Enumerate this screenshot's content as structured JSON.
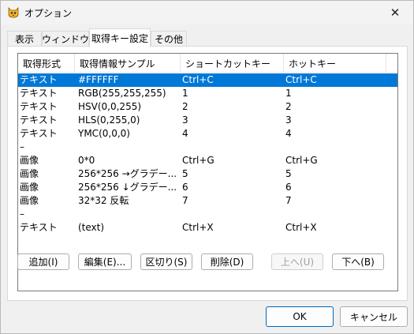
{
  "window": {
    "title": "オプション",
    "close_glyph": "✕"
  },
  "tabs": [
    {
      "label": "表示"
    },
    {
      "label": "ウィンドウ"
    },
    {
      "label": "取得キー設定"
    },
    {
      "label": "その他"
    }
  ],
  "list": {
    "headers": [
      "取得形式",
      "取得情報サンプル",
      "ショートカットキー",
      "ホットキー"
    ],
    "rows": [
      {
        "format": "テキスト",
        "sample": "#FFFFFF",
        "shortcut": "Ctrl+C",
        "hotkey": "Ctrl+C",
        "selected": true
      },
      {
        "format": "テキスト",
        "sample": "RGB(255,255,255)",
        "shortcut": "1",
        "hotkey": "1"
      },
      {
        "format": "テキスト",
        "sample": "HSV(0,0,255)",
        "shortcut": "2",
        "hotkey": "2"
      },
      {
        "format": "テキスト",
        "sample": "HLS(0,255,0)",
        "shortcut": "3",
        "hotkey": "3"
      },
      {
        "format": "テキスト",
        "sample": "YMC(0,0,0)",
        "shortcut": "4",
        "hotkey": "4"
      },
      {
        "format": "–",
        "sample": "",
        "shortcut": "",
        "hotkey": ""
      },
      {
        "format": "画像",
        "sample": "0*0",
        "shortcut": "Ctrl+G",
        "hotkey": "Ctrl+G"
      },
      {
        "format": "画像",
        "sample": "256*256 →グラデー...",
        "shortcut": "5",
        "hotkey": "5"
      },
      {
        "format": "画像",
        "sample": "256*256 ↓グラデー...",
        "shortcut": "6",
        "hotkey": "6"
      },
      {
        "format": "画像",
        "sample": "32*32 反転",
        "shortcut": "7",
        "hotkey": "7"
      },
      {
        "format": "–",
        "sample": "",
        "shortcut": "",
        "hotkey": ""
      },
      {
        "format": "テキスト",
        "sample": "(text)",
        "shortcut": "Ctrl+X",
        "hotkey": "Ctrl+X"
      }
    ]
  },
  "actions": {
    "add": "追加(I)",
    "edit": "編集(E)...",
    "separator": "区切り(S)",
    "delete": "削除(D)",
    "up": "上へ(U)",
    "down": "下へ(B)"
  },
  "footer": {
    "ok": "OK",
    "cancel": "キャンセル"
  },
  "colors": {
    "selection": "#0078d7",
    "accent": "#0067c0"
  }
}
